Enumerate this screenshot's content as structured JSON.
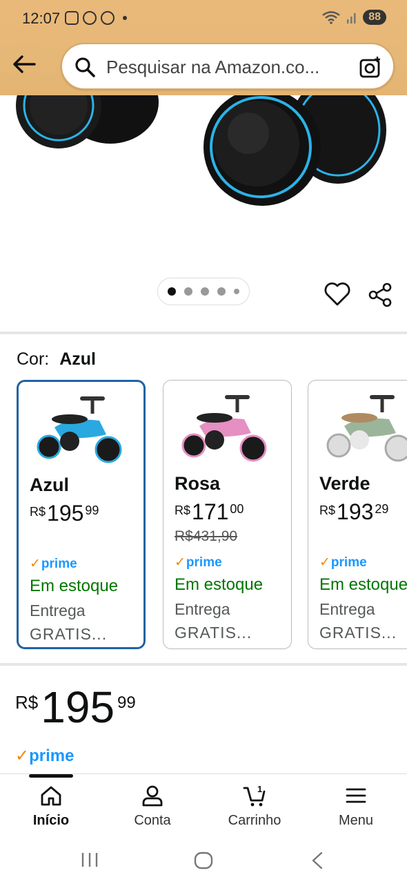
{
  "status": {
    "time": "12:07",
    "battery": "88"
  },
  "search": {
    "placeholder": "Pesquisar na Amazon.co..."
  },
  "gallery": {
    "pages": 5,
    "current": 1
  },
  "color": {
    "label": "Cor:",
    "selected": "Azul"
  },
  "variants": [
    {
      "name": "Azul",
      "currency": "R$",
      "whole": "195",
      "cents": "99",
      "old": "",
      "prime": "prime",
      "stock": "Em estoque",
      "ship1": "Entrega",
      "ship2": "GRATIS...",
      "body": "#29a9e0",
      "selected": true
    },
    {
      "name": "Rosa",
      "currency": "R$",
      "whole": "171",
      "cents": "00",
      "old": "R$431,90",
      "prime": "prime",
      "stock": "Em estoque",
      "ship1": "Entrega",
      "ship2": "GRATIS...",
      "body": "#e58fc3",
      "selected": false
    },
    {
      "name": "Verde",
      "currency": "R$",
      "whole": "193",
      "cents": "29",
      "old": "",
      "prime": "prime",
      "stock": "Em estoque",
      "ship1": "Entrega",
      "ship2": "GRATIS...",
      "body": "#9bb59b",
      "selected": false
    }
  ],
  "price": {
    "currency": "R$",
    "whole": "195",
    "cents": "99"
  },
  "prime_badge": "prime",
  "nav": [
    {
      "label": "Início",
      "icon": "home-icon",
      "active": true
    },
    {
      "label": "Conta",
      "icon": "account-icon",
      "active": false
    },
    {
      "label": "Carrinho",
      "icon": "cart-icon",
      "badge": "1",
      "active": false
    },
    {
      "label": "Menu",
      "icon": "menu-icon",
      "active": false
    }
  ],
  "colors": {
    "header": "#e6b877",
    "prime_blue": "#1a98ff",
    "in_stock": "#007600",
    "selected_border": "#2162a1"
  }
}
